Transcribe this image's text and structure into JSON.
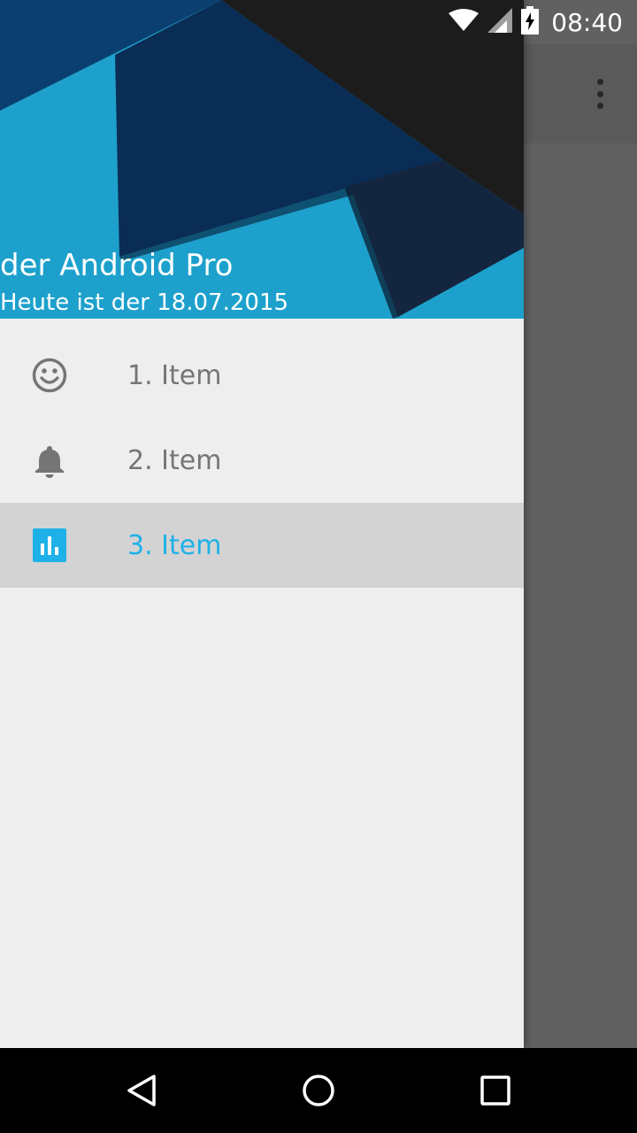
{
  "status_bar": {
    "time": "08:40",
    "icons": [
      "wifi-icon",
      "cellular-signal-icon",
      "battery-charging-icon"
    ]
  },
  "app_bar": {
    "overflow_icon": "more-vert-icon"
  },
  "drawer": {
    "header": {
      "title": "der Android Pro",
      "subtitle": "Heute ist der 18.07.2015"
    },
    "items": [
      {
        "label": "1. Item",
        "icon": "smiley-face-icon",
        "selected": false
      },
      {
        "label": "2. Item",
        "icon": "bell-icon",
        "selected": false
      },
      {
        "label": "3. Item",
        "icon": "bar-chart-icon",
        "selected": true
      }
    ]
  },
  "nav_bar": {
    "buttons": [
      "back-icon",
      "home-icon",
      "recents-icon"
    ]
  },
  "colors": {
    "accent": "#1eb1e8",
    "header_bg": "#1da1cc",
    "drawer_bg": "#eeeeee",
    "selected_row_bg": "#d3d3d3",
    "scrim": "#616161",
    "icon_gray": "#757575"
  }
}
